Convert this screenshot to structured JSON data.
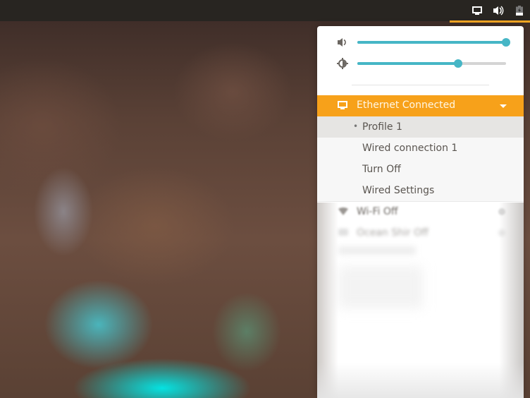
{
  "topbar": {
    "tray": [
      {
        "icon": "network-wired-icon",
        "label": "Network"
      },
      {
        "icon": "volume-high-icon",
        "label": "Volume"
      },
      {
        "icon": "battery-charging-icon",
        "label": "Battery"
      }
    ],
    "accent_color": "#f5a623"
  },
  "panel": {
    "sliders": {
      "volume": {
        "icon": "volume-icon",
        "value": 1.0
      },
      "brightness": {
        "icon": "brightness-icon",
        "value": 0.68
      }
    },
    "ethernet": {
      "label": "Ethernet Connected",
      "icon": "network-wired-icon",
      "expanded": true,
      "color": "#f7a11a",
      "items": [
        {
          "label": "Profile 1",
          "active": true,
          "bullet": "•"
        },
        {
          "label": "Wired connection 1",
          "active": false
        },
        {
          "label": "Turn Off",
          "active": false
        },
        {
          "label": "Wired Settings",
          "active": false
        }
      ]
    },
    "wifi": {
      "label": "Wi-Fi Off",
      "icon": "wifi-icon"
    },
    "blurred_row": {
      "label": "Ocean Shir Off"
    },
    "slider_color": "#46b6c6"
  }
}
